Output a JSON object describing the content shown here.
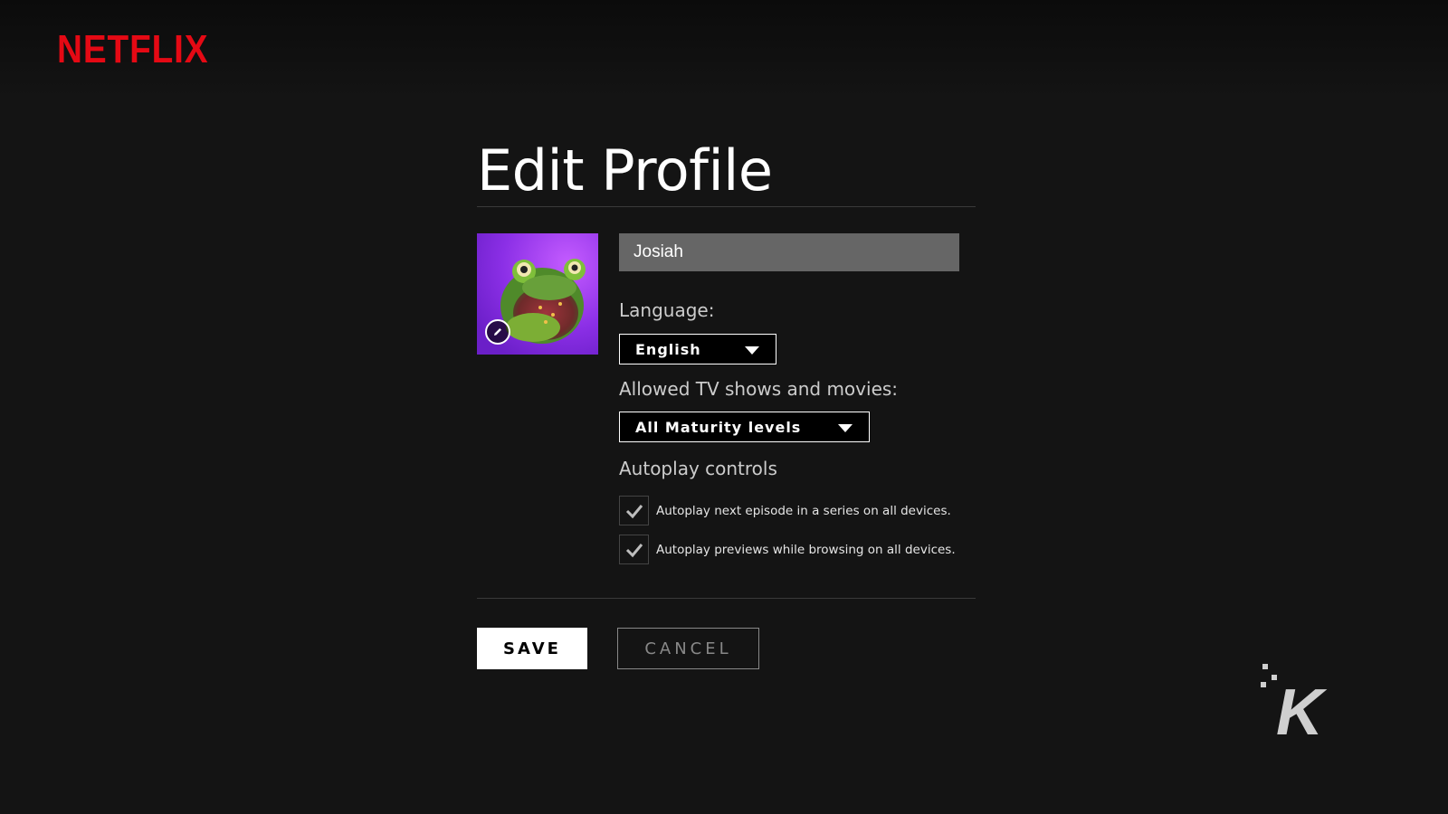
{
  "brand": {
    "logo_text": "NETFLIX",
    "logo_color": "#e50914"
  },
  "page": {
    "title": "Edit Profile"
  },
  "profile": {
    "avatar_icon": "frog-avatar",
    "edit_icon": "pencil-icon",
    "name_value": "Josiah"
  },
  "language": {
    "label": "Language:",
    "selected": "English"
  },
  "maturity": {
    "label": "Allowed TV shows and movies:",
    "selected": "All Maturity levels"
  },
  "autoplay": {
    "heading": "Autoplay controls",
    "options": [
      {
        "label": "Autoplay next episode in a series on all devices.",
        "checked": true
      },
      {
        "label": "Autoplay previews while browsing on all devices.",
        "checked": true
      }
    ]
  },
  "actions": {
    "save_label": "SAVE",
    "cancel_label": "CANCEL"
  },
  "watermark": {
    "icon": "k-logo-watermark",
    "text": "K"
  }
}
